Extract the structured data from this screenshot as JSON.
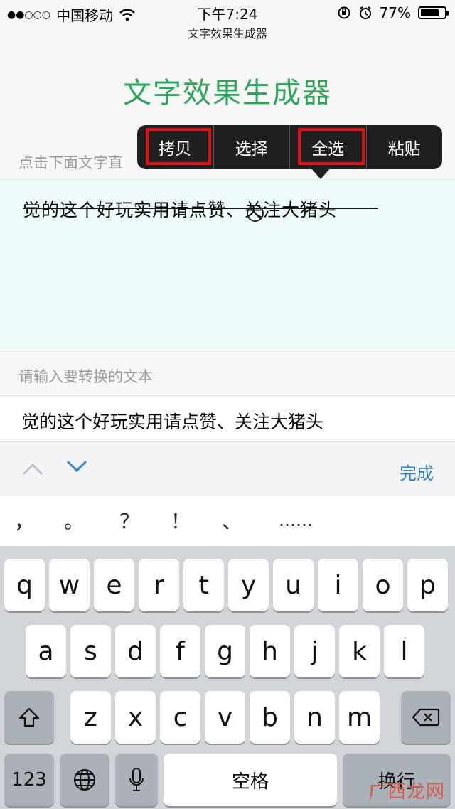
{
  "status_bar": {
    "signal": "●●○○○",
    "carrier": "中国移动",
    "time": "下午7:24",
    "page_name": "文字效果生成器",
    "battery": "77%",
    "battery_level": 0.77
  },
  "page": {
    "title": "文字效果生成器",
    "hint": "点击下面文字直",
    "preview_text": "觉的这个好玩实用请点赞、关注大猪头",
    "input_label": "请输入要转换的文本",
    "input_value": "觉的这个好玩实用请点赞、关注大猪头"
  },
  "context_menu": {
    "items": [
      "拷贝",
      "选择",
      "全选",
      "粘贴"
    ],
    "highlighted": [
      "拷贝",
      "全选"
    ],
    "highlight_color": "#e21010"
  },
  "accessory_bar": {
    "done_label": "完成"
  },
  "punctuation": [
    "，",
    "。",
    "？",
    "！",
    "、",
    "……"
  ],
  "keyboard": {
    "row1": [
      "q",
      "w",
      "e",
      "r",
      "t",
      "y",
      "u",
      "i",
      "o",
      "p"
    ],
    "row2": [
      "a",
      "s",
      "d",
      "f",
      "g",
      "h",
      "j",
      "k",
      "l"
    ],
    "row3": [
      "z",
      "x",
      "c",
      "v",
      "b",
      "n",
      "m"
    ],
    "numbers_label": "123",
    "space_label": "空格",
    "return_label": "换行"
  },
  "watermark": "广西龙网",
  "colors": {
    "title_green": "#2aa55a",
    "accent_blue": "#2f7fc4",
    "preview_bg": "#effcfc"
  }
}
